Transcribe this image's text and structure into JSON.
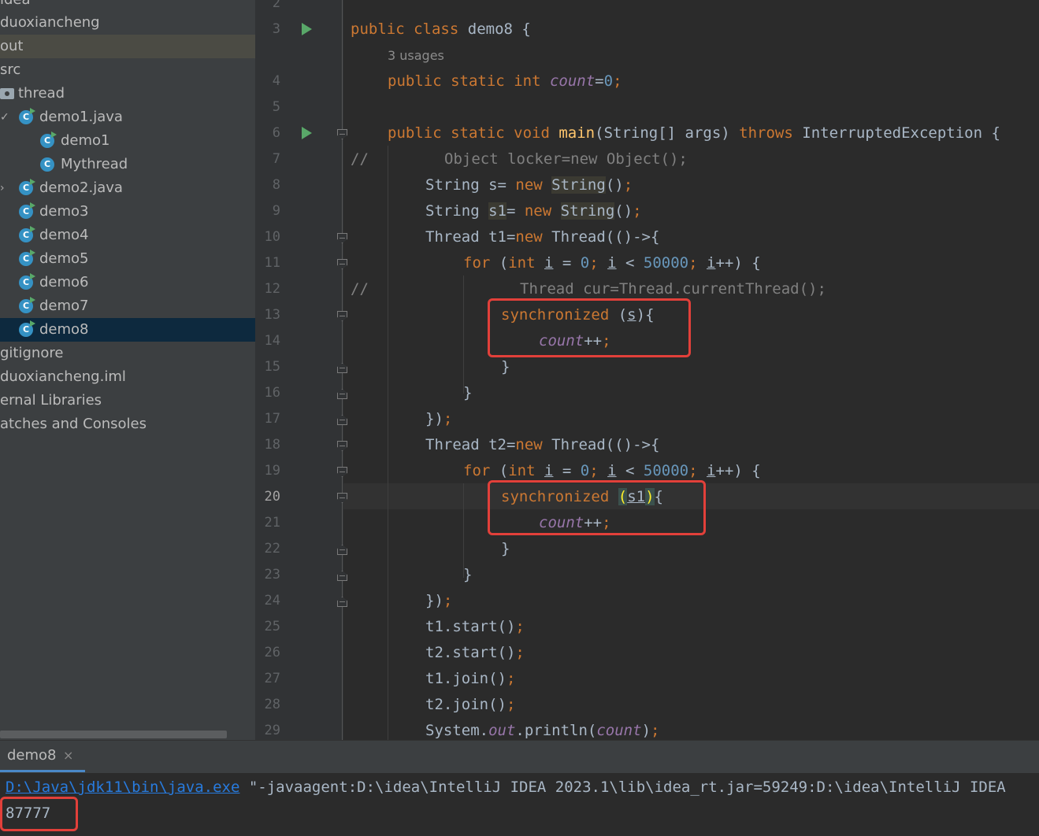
{
  "project_tree": {
    "items": [
      {
        "label": "idea"
      },
      {
        "label": "duoxiancheng"
      },
      {
        "label": "out"
      },
      {
        "label": "src"
      },
      {
        "label": "thread"
      },
      {
        "label": "demo1.java"
      },
      {
        "label": "demo1"
      },
      {
        "label": "Mythread"
      },
      {
        "label": "demo2.java"
      },
      {
        "label": "demo3"
      },
      {
        "label": "demo4"
      },
      {
        "label": "demo5"
      },
      {
        "label": "demo6"
      },
      {
        "label": "demo7"
      },
      {
        "label": "demo8"
      },
      {
        "label": "gitignore"
      },
      {
        "label": "duoxiancheng.iml"
      },
      {
        "label": "ernal Libraries"
      },
      {
        "label": "atches and Consoles"
      }
    ]
  },
  "editor": {
    "line_numbers": [
      "2",
      "3",
      "4",
      "5",
      "6",
      "7",
      "8",
      "9",
      "10",
      "11",
      "12",
      "13",
      "14",
      "15",
      "16",
      "17",
      "18",
      "19",
      "20",
      "21",
      "22",
      "23",
      "24",
      "25",
      "26",
      "27",
      "28",
      "29"
    ],
    "current_line": "20",
    "usages_hint": "3 usages",
    "code": {
      "l3_public": "public",
      "l3_class": "class",
      "l3_name": "demo8 {",
      "l4_public": "public",
      "l4_static": "static",
      "l4_int": "int",
      "l4_field": "count",
      "l4_eq": "=",
      "l4_zero": "0",
      "l4_semi": ";",
      "l6_mods": "public static void",
      "l6_main": "main",
      "l6_args": "(String[] args)",
      "l6_throws": "throws",
      "l6_exc": "InterruptedException {",
      "l7_cm": "//",
      "l7_text": "Object locker=new Object();",
      "l8_a": "String s= ",
      "l8_new": "new",
      "l8_type": "String",
      "l8_b": "()",
      "l8_semi": ";",
      "l9_a": "String ",
      "l9_var": "s1",
      "l9_b": "= ",
      "l9_new": "new",
      "l9_type": "String",
      "l9_c": "()",
      "l9_semi": ";",
      "l10_a": "Thread t1=",
      "l10_new": "new",
      "l10_b": " Thread(()->{",
      "l11_for": "for",
      "l11_a": " (",
      "l11_int": "int",
      "l11_i": "i",
      "l11_b": " = ",
      "l11_zero": "0",
      "l11_s1": "; ",
      "l11_i2": "i",
      "l11_c": " < ",
      "l11_n": "50000",
      "l11_s2": "; ",
      "l11_i3": "i",
      "l11_d": "++) {",
      "l12_cm": "//",
      "l12_text": "Thread cur=Thread.currentThread();",
      "l13_sync": "synchronized",
      "l13_a": " (",
      "l13_var": "s",
      "l13_b": "){",
      "l14_field": "count",
      "l14_op": "++",
      "l14_semi": ";",
      "l15": "}",
      "l16": "}",
      "l17_a": "})",
      "l17_semi": ";",
      "l18_a": "Thread t2=",
      "l18_new": "new",
      "l18_b": " Thread(()->{",
      "l19_for": "for",
      "l19_a": " (",
      "l19_int": "int",
      "l19_i": "i",
      "l19_b": " = ",
      "l19_zero": "0",
      "l19_s1": "; ",
      "l19_i2": "i",
      "l19_c": " < ",
      "l19_n": "50000",
      "l19_s2": "; ",
      "l19_i3": "i",
      "l19_d": "++) {",
      "l20_sync": "synchronized",
      "l20_sp": " ",
      "l20_po": "(",
      "l20_var": "s1",
      "l20_pc": ")",
      "l20_b": "{",
      "l21_field": "count",
      "l21_op": "++",
      "l21_semi": ";",
      "l22": "}",
      "l23": "}",
      "l24_a": "})",
      "l24_semi": ";",
      "l25_a": "t1.start()",
      "l25_semi": ";",
      "l26_a": "t2.start()",
      "l26_semi": ";",
      "l27_a": "t1.join()",
      "l27_semi": ";",
      "l28_a": "t2.join()",
      "l28_semi": ";",
      "l29_a": "System.",
      "l29_out": "out",
      "l29_b": ".println(",
      "l29_field": "count",
      "l29_c": ")",
      "l29_semi": ";"
    }
  },
  "run_panel": {
    "tab_label": "demo8",
    "close_glyph": "×",
    "java_path": "D:\\Java\\jdk11\\bin\\java.exe",
    "java_args": " \"-javaagent:D:\\idea\\IntelliJ IDEA 2023.1\\lib\\idea_rt.jar=59249:D:\\idea\\IntelliJ IDEA",
    "output": "87777"
  },
  "colors": {
    "highlight_box": "#e2403a",
    "keyword": "#cc7832",
    "number": "#6897bb",
    "field": "#9876aa"
  }
}
